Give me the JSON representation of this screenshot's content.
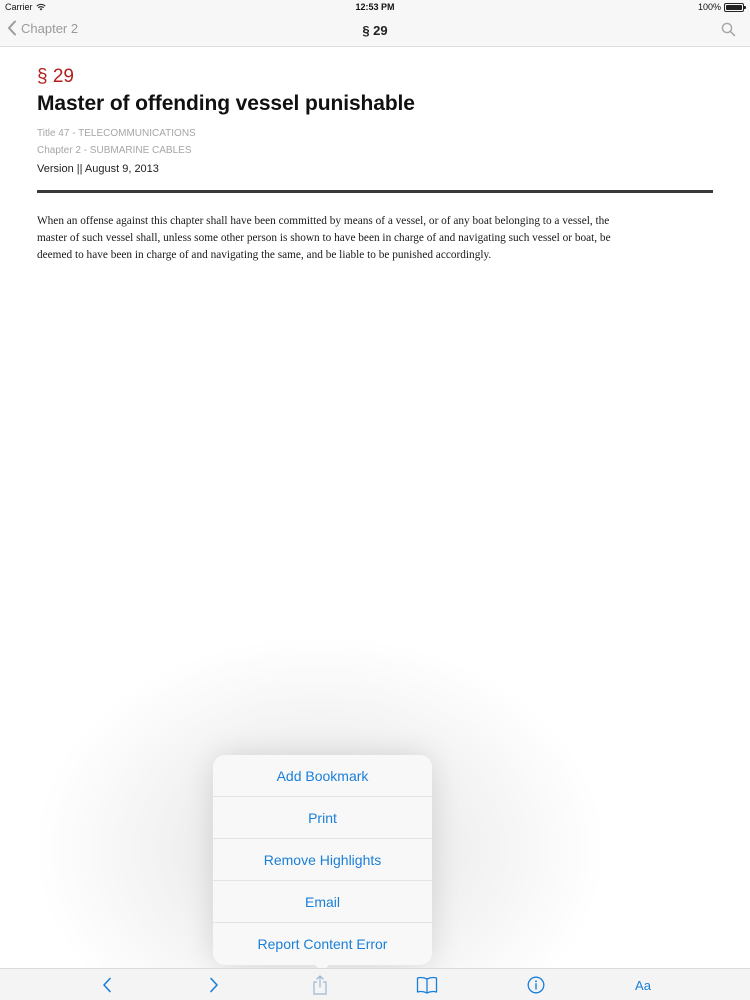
{
  "status_bar": {
    "carrier": "Carrier",
    "time": "12:53 PM",
    "battery_percent": "100%",
    "battery_level": 1.0
  },
  "nav": {
    "back_label": "Chapter 2",
    "title": "§ 29",
    "search_icon": "search-icon"
  },
  "document": {
    "section_number": "§ 29",
    "section_title": "Master of offending vessel punishable",
    "title_line": "Title 47 - TELECOMMUNICATIONS",
    "chapter_line": "Chapter 2 - SUBMARINE CABLES",
    "version_line": "Version || August 9, 2013",
    "body": [
      "When an offense against this chapter shall have been committed by means of a vessel, or of any boat belonging to a vessel, the",
      "master of such vessel shall, unless some other person is shown to have been in charge of and navigating such vessel or boat, be",
      "deemed to have been in charge of and navigating the same, and be liable to be punished accordingly."
    ]
  },
  "popover": {
    "items": [
      "Add Bookmark",
      "Print",
      "Remove Highlights",
      "Email",
      "Report Content Error"
    ]
  },
  "toolbar": {
    "font_label": "Aa",
    "icons": [
      "back-arrow-icon",
      "forward-arrow-icon",
      "share-icon",
      "book-icon",
      "info-icon"
    ]
  },
  "colors": {
    "accent": "#1a7fd8",
    "section_red": "#b0211c"
  }
}
